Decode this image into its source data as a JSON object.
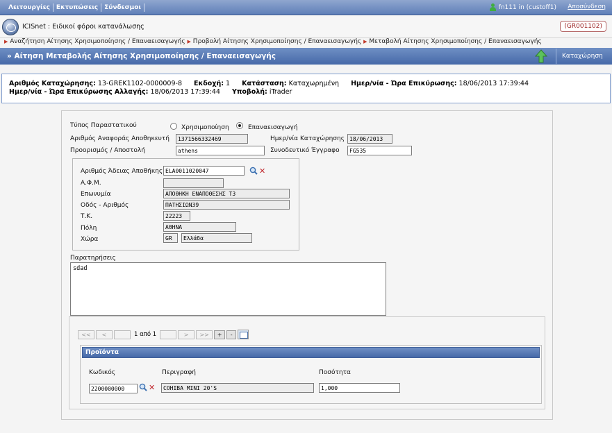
{
  "topbar": {
    "menu": [
      "Λειτουργίες",
      "Εκτυπώσεις",
      "Σύνδεσμοι"
    ],
    "user": "fn111 in (custoff1)",
    "logout": "Αποσύνδεση"
  },
  "app": {
    "name": "ICISnet",
    "subtitle": " : Ειδικοί φόροι κατανάλωσης",
    "office_code": "(GR001102)"
  },
  "breadcrumbs": [
    "Αναζήτηση Αίτησης Χρησιμοποίησης / Επαναεισαγωγής",
    "Προβολή Αίτησης Χρησιμοποίησης / Επαναεισαγωγής",
    "Μεταβολή Αίτησης Χρησιμοποίησης / Επαναεισαγωγής"
  ],
  "page": {
    "title": "» Αίτηση Μεταβολής Αίτησης Χρησιμοποίησης / Επαναεισαγωγής",
    "save_label": "Καταχώρηση"
  },
  "info": {
    "reg_no_label": "Αριθμός Καταχώρησης:",
    "reg_no": "13-GREK1102-0000009-8",
    "version_label": "Εκδοχή:",
    "version": "1",
    "status_label": "Κατάσταση:",
    "status": "Καταχωρημένη",
    "validation_label": "Ημερ/νία - Ώρα Επικύρωσης:",
    "validation": "18/06/2013 17:39:44",
    "change_validation_label": "Ημερ/νία - Ώρα Επικύρωσης Αλλαγής:",
    "change_validation": "18/06/2013 17:39:44",
    "submission_label": "Υποβολή:",
    "submission": "iTrader"
  },
  "form": {
    "doc_type_label": "Τύπος Παραστατικού",
    "option_use": "Χρησιμοποίηση",
    "option_reimport": "Επαναεισαγωγή",
    "selected_option": "Επαναεισαγωγή",
    "warehouse_ref_label": "Αριθμός Αναφοράς Αποθηκευτή",
    "warehouse_ref": "1371566332469",
    "reg_date_label": "Ημερ/νία Καταχώρησης",
    "reg_date": "18/06/2013",
    "destination_label": "Προορισμός / Αποστολή",
    "destination": "athens",
    "accompanying_doc_label": "Συνοδευτικό Έγγραφο",
    "accompanying_doc": "FG535",
    "licence_label": "Αριθμός Άδειας Αποθήκης",
    "licence": "ELA0011020047",
    "vat_label": "Α.Φ.Μ.",
    "vat": "",
    "name_label": "Επωνυμία",
    "name": "ΑΠΟΘΗΚΗ ΕΝΑΠΟΘΕΣΗΣ Τ3",
    "street_label": "Οδός - Αριθμός",
    "street": "ΠΑΤΗΣΙΩΝ39",
    "postcode_label": "Τ.Κ.",
    "postcode": "22223",
    "city_label": "Πόλη",
    "city": "ΑΘΗΝΑ",
    "country_label": "Χώρα",
    "country_code": "GR",
    "country_name": "Ελλάδα",
    "notes_label": "Παρατηρήσεις",
    "notes": "sdad"
  },
  "pager": {
    "first": "<<",
    "prev": "<",
    "page_info": "1 από 1",
    "next": ">",
    "last": ">>",
    "add": "+",
    "remove": "-"
  },
  "products": {
    "header": "Προϊόντα",
    "col_code": "Κωδικός",
    "col_desc": "Περιγραφή",
    "col_qty": "Ποσότητα",
    "rows": [
      {
        "code": "2200000000",
        "desc": "COHIBA MINI 20'S",
        "qty": "1,000"
      }
    ]
  }
}
